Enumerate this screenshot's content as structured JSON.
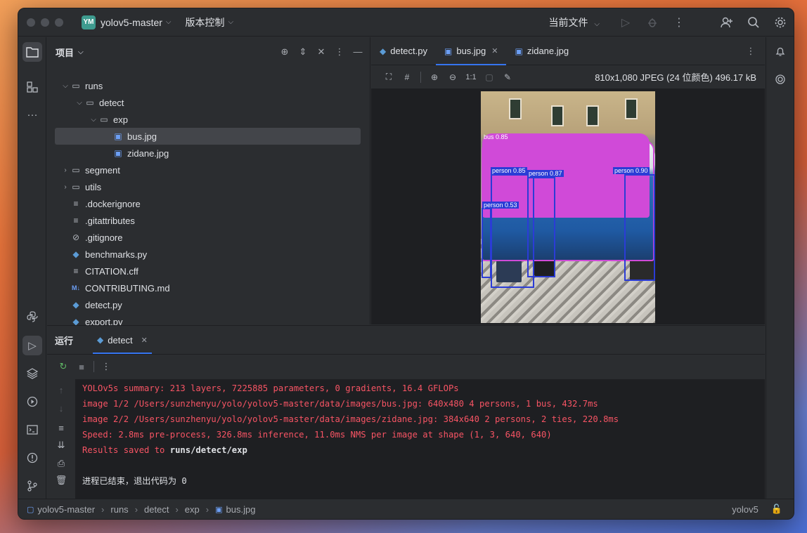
{
  "titlebar": {
    "project_badge": "YM",
    "project_name": "yolov5-master",
    "vcs_label": "版本控制",
    "run_config": "当前文件"
  },
  "project_panel": {
    "title": "项目",
    "tree": [
      {
        "label": "runs",
        "type": "folder",
        "expanded": true,
        "depth": 1
      },
      {
        "label": "detect",
        "type": "folder",
        "expanded": true,
        "depth": 2
      },
      {
        "label": "exp",
        "type": "folder",
        "expanded": true,
        "depth": 3
      },
      {
        "label": "bus.jpg",
        "type": "image",
        "depth": 4,
        "selected": true
      },
      {
        "label": "zidane.jpg",
        "type": "image",
        "depth": 4
      },
      {
        "label": "segment",
        "type": "folder",
        "expanded": false,
        "depth": 1
      },
      {
        "label": "utils",
        "type": "package",
        "expanded": false,
        "depth": 1
      },
      {
        "label": ".dockerignore",
        "type": "text",
        "depth": 1
      },
      {
        "label": ".gitattributes",
        "type": "text",
        "depth": 1
      },
      {
        "label": ".gitignore",
        "type": "ignore",
        "depth": 1
      },
      {
        "label": "benchmarks.py",
        "type": "python",
        "depth": 1
      },
      {
        "label": "CITATION.cff",
        "type": "text",
        "depth": 1
      },
      {
        "label": "CONTRIBUTING.md",
        "type": "markdown",
        "depth": 1
      },
      {
        "label": "detect.py",
        "type": "python",
        "depth": 1
      },
      {
        "label": "export.py",
        "type": "python",
        "depth": 1
      }
    ]
  },
  "editor": {
    "tabs": [
      {
        "label": "detect.py",
        "icon": "python-icon"
      },
      {
        "label": "bus.jpg",
        "icon": "image-icon",
        "active": true
      },
      {
        "label": "zidane.jpg",
        "icon": "image-icon"
      }
    ],
    "image_toolbar": {
      "actual_size": "1:1",
      "info": "810x1,080 JPEG (24 位颜色) 496.17 kB"
    },
    "detections": [
      {
        "label": "bus 0.85"
      },
      {
        "label": "person 0.85"
      },
      {
        "label": "person 0.87"
      },
      {
        "label": "person 0.90"
      },
      {
        "label": "person 0.53"
      }
    ]
  },
  "run_panel": {
    "title": "运行",
    "tab": "detect",
    "output": [
      {
        "text": "YOLOv5s summary: 213 layers, 7225885 parameters, 0 gradients, 16.4 GFLOPs",
        "style": "err"
      },
      {
        "text": "image 1/2 /Users/sunzhenyu/yolo/yolov5-master/data/images/bus.jpg: 640x480 4 persons, 1 bus, 432.7ms",
        "style": "err"
      },
      {
        "text": "image 2/2 /Users/sunzhenyu/yolo/yolov5-master/data/images/zidane.jpg: 384x640 2 persons, 2 ties, 220.8ms",
        "style": "err"
      },
      {
        "text": "Speed: 2.8ms pre-process, 326.8ms inference, 11.0ms NMS per image at shape (1, 3, 640, 640)",
        "style": "err"
      },
      {
        "text_prefix": "Results saved to ",
        "text_bold": "runs/detect/exp",
        "style": "err"
      },
      {
        "text": "",
        "style": "norm"
      },
      {
        "text": "进程已结束，退出代码为 0",
        "style": "norm"
      }
    ]
  },
  "statusbar": {
    "breadcrumb": [
      "yolov5-master",
      "runs",
      "detect",
      "exp",
      "bus.jpg"
    ],
    "interpreter": "yolov5"
  },
  "colors": {
    "accent": "#3574f0",
    "error_text": "#f75464",
    "bbox_person": "#2b3cd6",
    "bbox_bus": "#d04ad8"
  }
}
